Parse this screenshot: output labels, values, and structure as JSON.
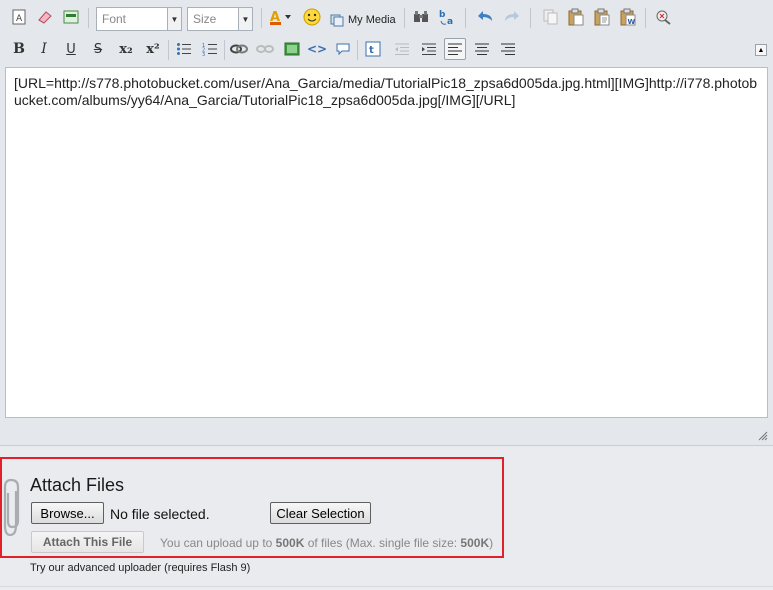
{
  "toolbar": {
    "font_placeholder": "Font",
    "size_placeholder": "Size",
    "my_media_label": "My Media",
    "row1_icons": [
      "source-mode-icon",
      "remove-format-icon",
      "toggle-toolbar-icon",
      "text-color-icon",
      "smiley-icon",
      "my-media-icon",
      "find-icon",
      "replace-icon",
      "undo-icon",
      "redo-icon",
      "copy-icon",
      "paste-icon",
      "paste-text-icon",
      "paste-word-icon",
      "spellcheck-icon"
    ],
    "row2_icons": [
      "bold-icon",
      "italic-icon",
      "underline-icon",
      "strikethrough-icon",
      "subscript-icon",
      "superscript-icon",
      "bulleted-list-icon",
      "numbered-list-icon",
      "link-icon",
      "unlink-icon",
      "image-icon",
      "code-icon",
      "quote-icon",
      "paragraph-icon",
      "outdent-icon",
      "indent-icon",
      "align-left-icon",
      "align-center-icon",
      "align-right-icon"
    ],
    "bold_glyph": "B",
    "italic_glyph": "I",
    "underline_glyph": "U",
    "strike_glyph": "S",
    "subscript_glyph": "x₂",
    "superscript_glyph": "x²",
    "active_alignment": "left"
  },
  "editor": {
    "content": "[URL=http://s778.photobucket.com/user/Ana_Garcia/media/TutorialPic18_zpsa6d005da.jpg.html][IMG]http://i778.photobucket.com/albums/yy64/Ana_Garcia/TutorialPic18_zpsa6d005da.jpg[/IMG][/URL]"
  },
  "attach": {
    "title": "Attach Files",
    "browse_label": "Browse...",
    "no_file_text": "No file selected.",
    "clear_label": "Clear Selection",
    "attach_label": "Attach This File",
    "upload_prefix": "You can upload up to ",
    "upload_limit": "500K",
    "upload_middle": " of files (Max. single file size: ",
    "single_limit": "500K",
    "upload_suffix": ")",
    "advanced_text": "Try our advanced uploader (requires Flash 9)"
  },
  "colors": {
    "highlight_border": "#e0202a",
    "editor_bg": "#ffffff",
    "toolbar_bg": "#e4e7eb"
  }
}
